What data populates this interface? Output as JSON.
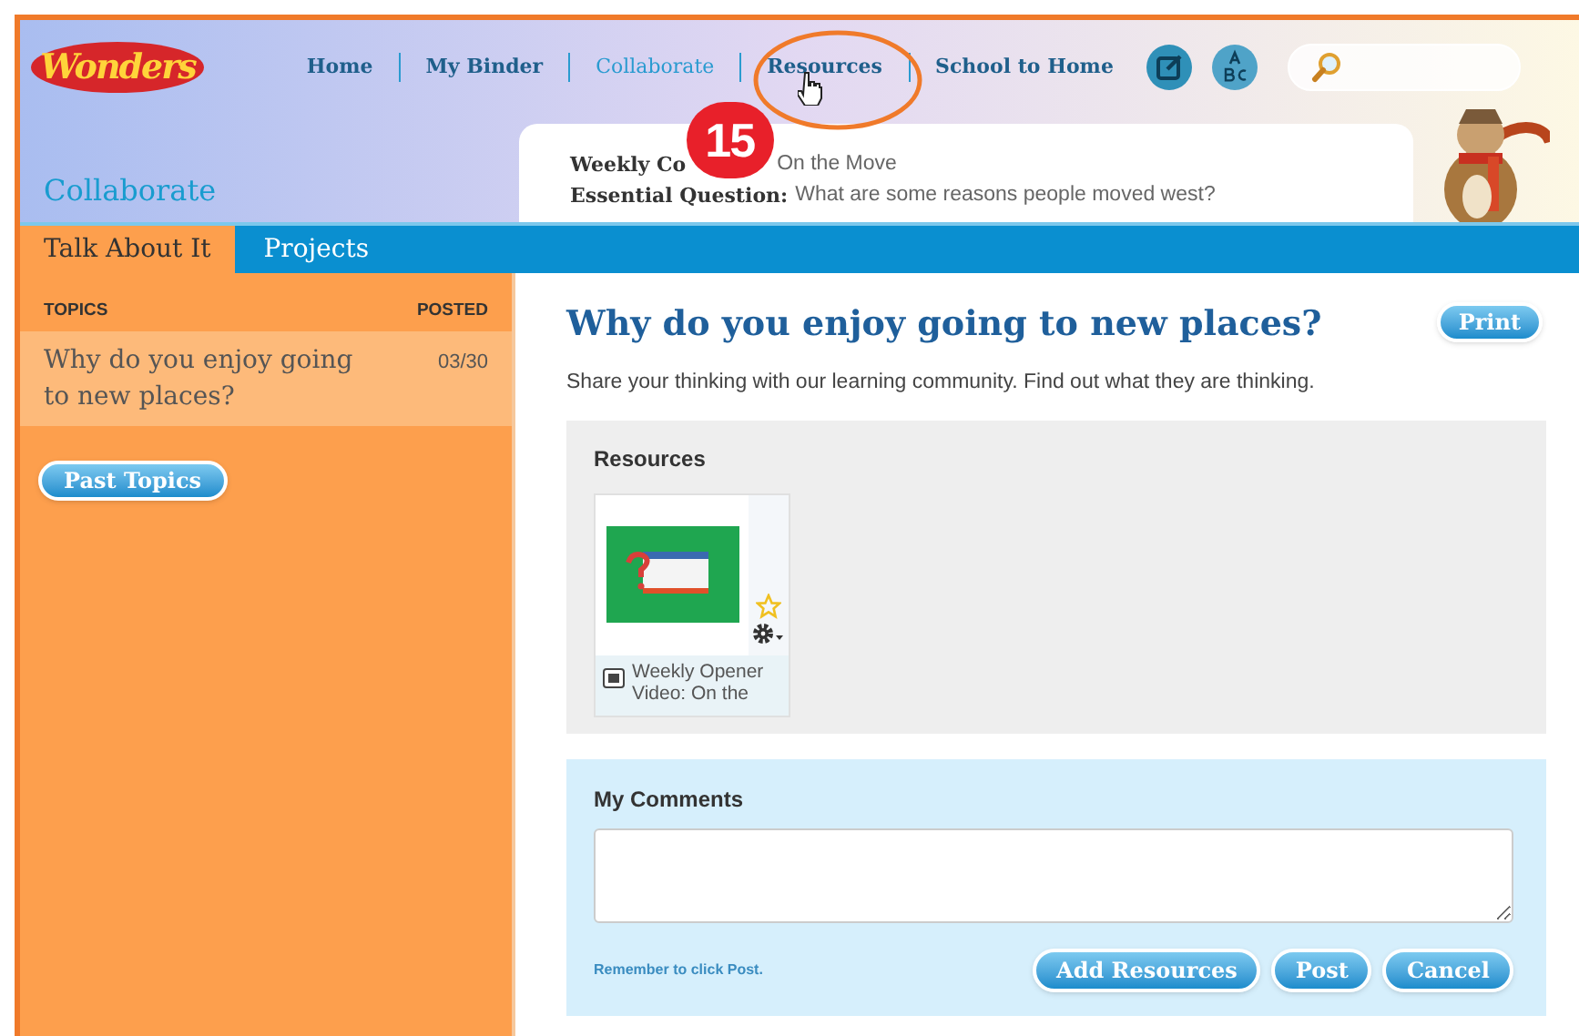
{
  "logo": "Wonders",
  "nav": [
    {
      "label": "Home",
      "selected": false
    },
    {
      "label": "My Binder",
      "selected": false
    },
    {
      "label": "Collaborate",
      "selected": true
    },
    {
      "label": "Resources",
      "selected": false
    },
    {
      "label": "School to Home",
      "selected": false
    }
  ],
  "section_title": "Collaborate",
  "weekly_concept": {
    "label": "Weekly Co",
    "value": "On the Move"
  },
  "essential_question": {
    "label": "Essential Question:",
    "value": "What are some reasons people moved west?"
  },
  "tabs": [
    {
      "label": "Talk About It",
      "selected": true
    },
    {
      "label": "Projects",
      "selected": false
    }
  ],
  "topics": {
    "columns": [
      "TOPICS",
      "POSTED"
    ],
    "rows": [
      {
        "title": "Why do you enjoy going to new places?",
        "posted": "03/30",
        "selected": true
      }
    ]
  },
  "past_topics_button": "Past Topics",
  "discussion": {
    "title": "Why do you enjoy going to new places?",
    "print_button": "Print",
    "description": "Share your thinking with our learning community. Find out what they are thinking."
  },
  "resources": {
    "heading": "Resources",
    "items": [
      {
        "title": "Weekly Opener Video: On the"
      }
    ]
  },
  "comments": {
    "heading": "My Comments",
    "hint": "Remember to click Post.",
    "buttons": [
      "Add Resources",
      "Post",
      "Cancel"
    ]
  },
  "annotation": {
    "number": "15"
  }
}
